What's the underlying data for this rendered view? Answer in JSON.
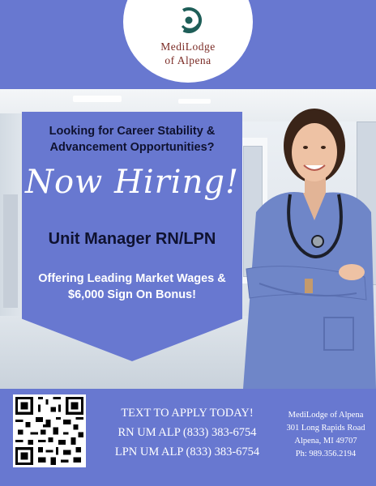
{
  "brand": {
    "name_line1": "MediLodge",
    "name_line2": "of Alpena",
    "logo_color": "#1e5e58",
    "name_color": "#7a2a24"
  },
  "banner": {
    "headline_line1": "Looking for Career Stability &",
    "headline_line2": "Advancement Opportunities?",
    "script_heading": "Now Hiring!",
    "position": "Unit Manager RN/LPN",
    "offer_line1": "Offering Leading Market Wages &",
    "offer_line2": "$6,000 Sign On Bonus!"
  },
  "apply": {
    "call_to_action": "TEXT TO APPLY TODAY!",
    "rn_line": "RN UM ALP (833) 383-6754",
    "lpn_line": "LPN UM ALP (833) 383-6754"
  },
  "contact": {
    "facility": "MediLodge of Alpena",
    "street": "301 Long Rapids Road",
    "city": "Alpena, MI 49707",
    "phone": "Ph: 989.356.2194"
  },
  "colors": {
    "periwinkle": "#6878d0",
    "dark_text": "#0f1230",
    "white": "#ffffff",
    "scrubs": "#6f86c8"
  },
  "icons": {
    "logo": "medilodge-swirl-logo",
    "qr": "qr-code-icon"
  }
}
